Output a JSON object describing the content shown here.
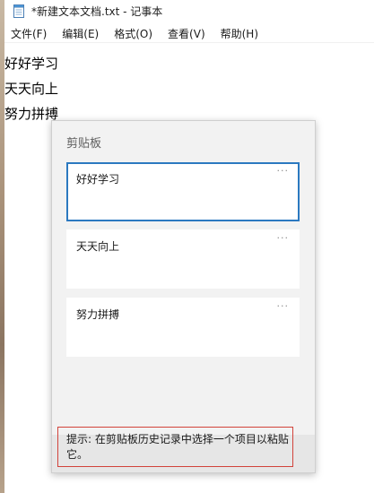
{
  "window": {
    "title": "*新建文本文档.txt - 记事本"
  },
  "menu": {
    "items": [
      "文件(F)",
      "编辑(E)",
      "格式(O)",
      "查看(V)",
      "帮助(H)"
    ]
  },
  "editor": {
    "lines": [
      "好好学习",
      "天天向上",
      "努力拼搏"
    ]
  },
  "clipboard": {
    "title": "剪贴板",
    "items": [
      {
        "text": "好好学习",
        "more": "···",
        "selected": true
      },
      {
        "text": "天天向上",
        "more": "···",
        "selected": false
      },
      {
        "text": "努力拼搏",
        "more": "···",
        "selected": false
      }
    ],
    "hint": "提示: 在剪贴板历史记录中选择一个项目以粘贴它。"
  },
  "colors": {
    "accent": "#2b79c0",
    "hint_border": "#d2433b",
    "panel_bg": "#f2f2f2"
  }
}
